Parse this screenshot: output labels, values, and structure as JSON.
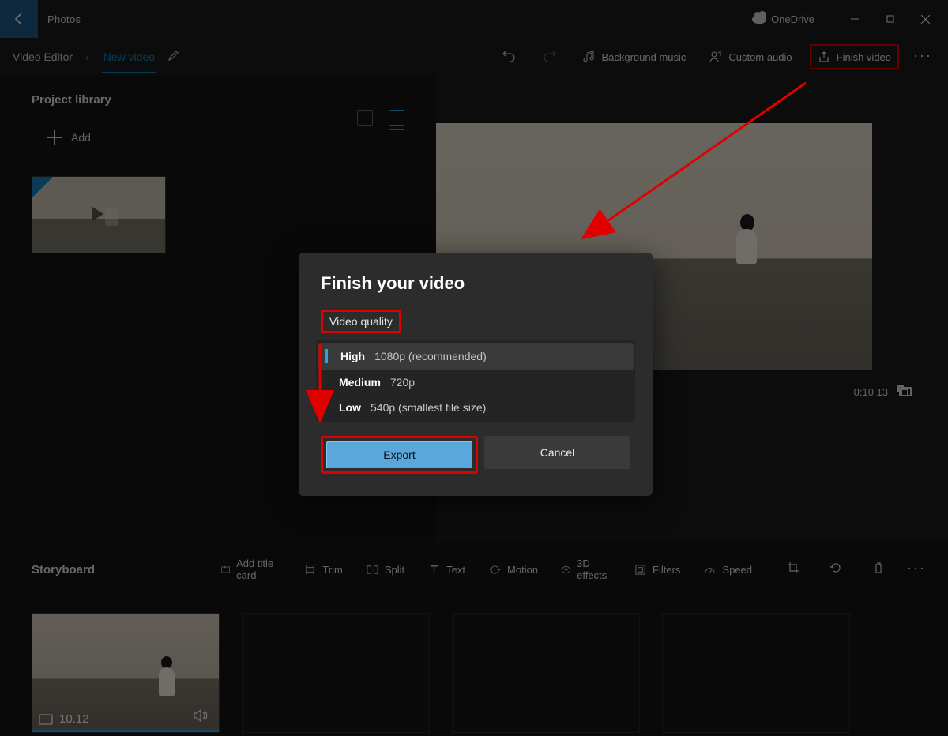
{
  "titlebar": {
    "app_name": "Photos",
    "onedrive_label": "OneDrive"
  },
  "toolbar": {
    "section": "Video Editor",
    "project_name": "New video",
    "background_music": "Background music",
    "custom_audio": "Custom audio",
    "finish_video": "Finish video"
  },
  "library": {
    "title": "Project library",
    "add_label": "Add"
  },
  "preview": {
    "current_time": "0:10.13"
  },
  "storyboard": {
    "title": "Storyboard",
    "add_title_card": "Add title card",
    "trim": "Trim",
    "split": "Split",
    "text": "Text",
    "motion": "Motion",
    "effects3d": "3D effects",
    "filters": "Filters",
    "speed": "Speed",
    "clip_duration": "10.12"
  },
  "dialog": {
    "title": "Finish your video",
    "quality_label": "Video quality",
    "options": [
      {
        "name": "High",
        "detail": "1080p (recommended)"
      },
      {
        "name": "Medium",
        "detail": "720p"
      },
      {
        "name": "Low",
        "detail": "540p (smallest file size)"
      }
    ],
    "export": "Export",
    "cancel": "Cancel"
  }
}
